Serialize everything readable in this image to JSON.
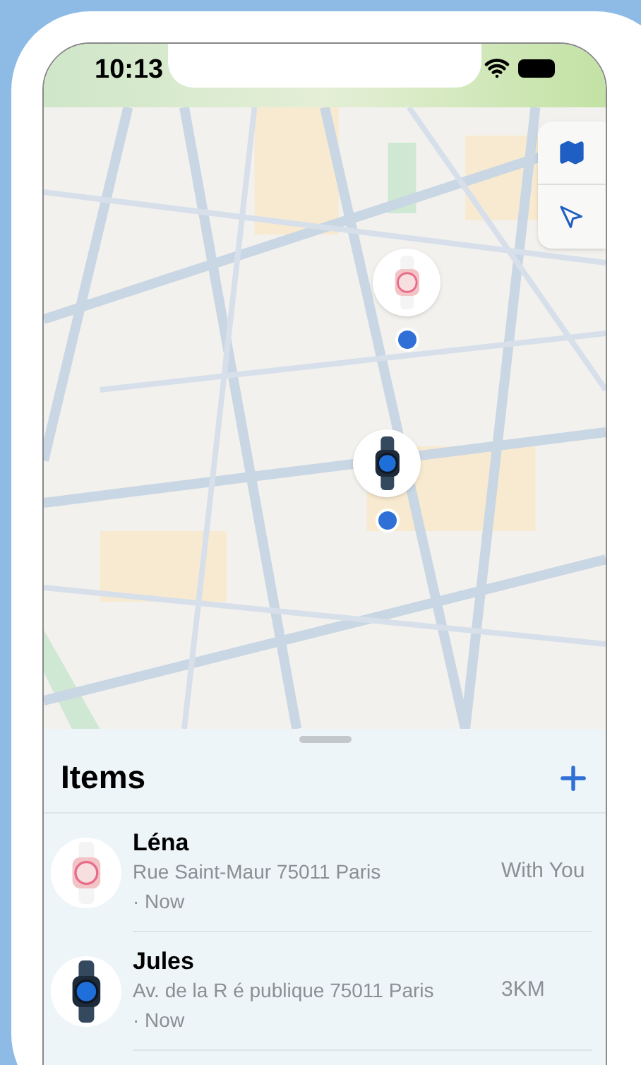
{
  "status_bar": {
    "time": "10:13"
  },
  "sheet": {
    "title": "Items",
    "items": [
      {
        "name": "Léna",
        "kind": "pink",
        "address": "Rue Saint-Maur 75011 Paris",
        "time": "· Now",
        "status": "With You"
      },
      {
        "name": "Jules",
        "kind": "navy",
        "address": "Av. de la R é publique 75011 Paris",
        "time": "· Now",
        "status": "3KM"
      }
    ]
  }
}
